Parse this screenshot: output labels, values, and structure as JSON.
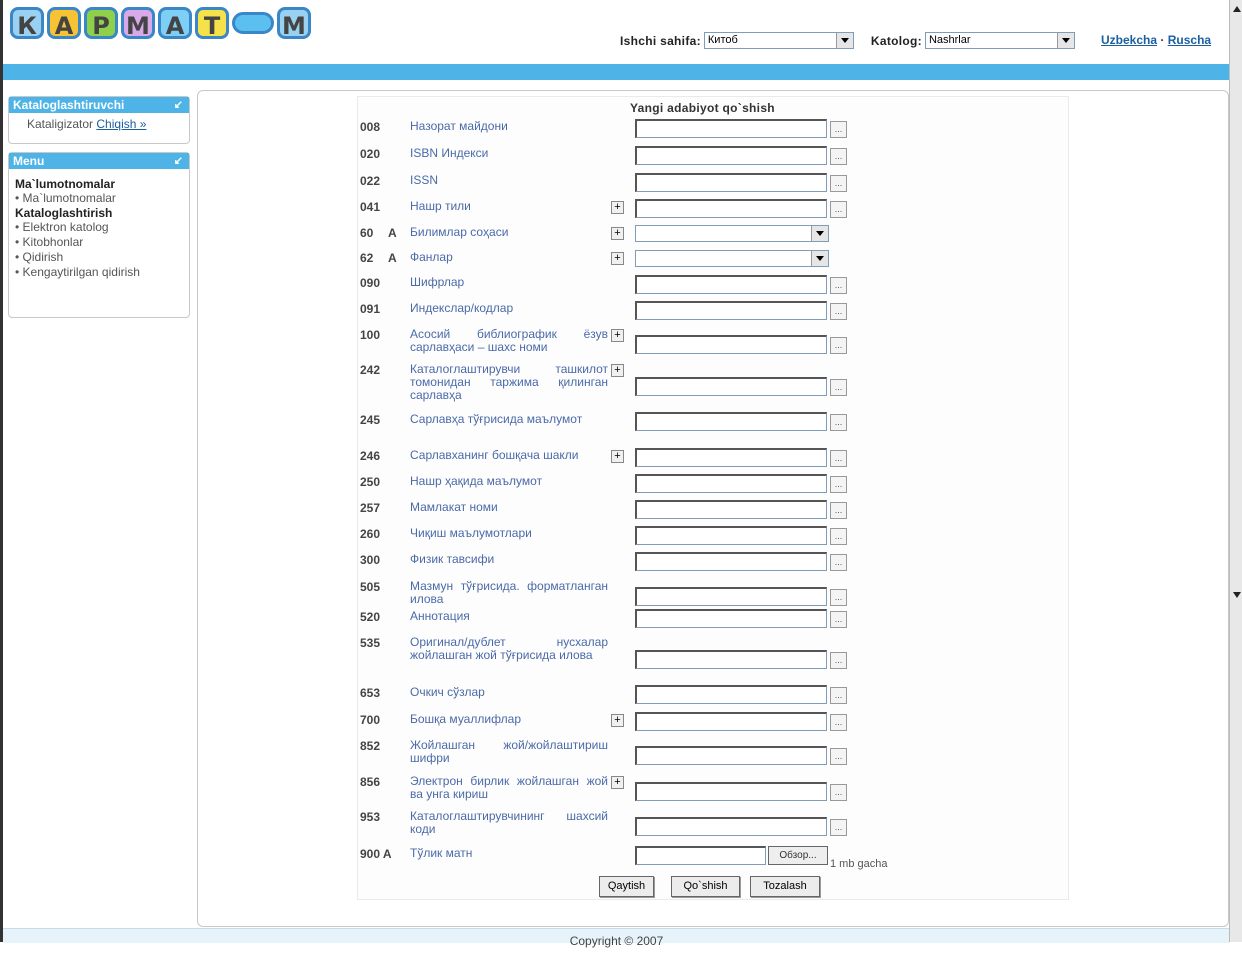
{
  "logo": {
    "letters": [
      "К",
      "А",
      "Р",
      "М",
      "А",
      "Т",
      "",
      "М"
    ]
  },
  "header": {
    "work_page_label": "Ishchi sahifa:",
    "work_page_value": "Китоб",
    "catalog_label": "Katolog:",
    "catalog_value": "Nashrlar",
    "lang_uz": "Uzbekcha",
    "lang_sep": "·",
    "lang_ru": "Ruscha"
  },
  "sidebar": {
    "box1": {
      "title": "Kataloglashtiruvchi",
      "user": "Kataligizator",
      "logout": "Chiqish »"
    },
    "box2": {
      "title": "Menu",
      "group1": "Ma`lumotnomalar",
      "group1_items": [
        "Ma`lumotnomalar"
      ],
      "group2": "Kataloglashtirish",
      "group2_items": [
        "Elektron katolog",
        "Kitobhonlar",
        "Qidirish",
        "Kengaytirilgan qidirish"
      ]
    }
  },
  "form": {
    "title": "Yangi adabiyot qo`shish",
    "fields": [
      {
        "code": "008",
        "flag": "",
        "label": "Назорат майдони",
        "plus": false,
        "type": "text"
      },
      {
        "code": "020",
        "flag": "",
        "label": "ISBN Индекси",
        "plus": false,
        "type": "text"
      },
      {
        "code": "022",
        "flag": "",
        "label": "ISSN",
        "plus": false,
        "type": "text"
      },
      {
        "code": "041",
        "flag": "",
        "label": "Нашр тили",
        "plus": true,
        "type": "text"
      },
      {
        "code": "60",
        "flag": "A",
        "label": "Билимлар соҳаси",
        "plus": true,
        "type": "select"
      },
      {
        "code": "62",
        "flag": "A",
        "label": "Фанлар",
        "plus": true,
        "type": "select"
      },
      {
        "code": "090",
        "flag": "",
        "label": "Шифрлар",
        "plus": false,
        "type": "text"
      },
      {
        "code": "091",
        "flag": "",
        "label": "Индекслар/кодлар",
        "plus": false,
        "type": "text"
      },
      {
        "code": "100",
        "flag": "",
        "label": "Асосий библиографик ёзув сарлавҳаси – шахс номи",
        "plus": true,
        "type": "text"
      },
      {
        "code": "242",
        "flag": "",
        "label": "Каталоглаштирувчи ташкилот томонидан таржима қилинган сарлавҳа",
        "plus": true,
        "type": "text"
      },
      {
        "code": "245",
        "flag": "",
        "label": "Сарлавҳа тўғрисида маълумот",
        "plus": false,
        "type": "text"
      },
      {
        "code": "246",
        "flag": "",
        "label": "Сарлавханинг бошқача шакли",
        "plus": true,
        "type": "text"
      },
      {
        "code": "250",
        "flag": "",
        "label": "Нашр ҳақида маълумот",
        "plus": false,
        "type": "text"
      },
      {
        "code": "257",
        "flag": "",
        "label": "Мамлакат номи",
        "plus": false,
        "type": "text"
      },
      {
        "code": "260",
        "flag": "",
        "label": "Чиқиш маълумотлари",
        "plus": false,
        "type": "text"
      },
      {
        "code": "300",
        "flag": "",
        "label": "Физик тавсифи",
        "plus": false,
        "type": "text"
      },
      {
        "code": "505",
        "flag": "",
        "label": "Мазмун тўғрисида. форматланган илова",
        "plus": false,
        "type": "text"
      },
      {
        "code": "520",
        "flag": "",
        "label": "Аннотация",
        "plus": false,
        "type": "text"
      },
      {
        "code": "535",
        "flag": "",
        "label": "Оригинал/дублет нусхалар жойлашган жой тўғрисида илова",
        "plus": false,
        "type": "text"
      },
      {
        "code": "653",
        "flag": "",
        "label": "Очкич сўзлар",
        "plus": false,
        "type": "text"
      },
      {
        "code": "700",
        "flag": "",
        "label": "Бошқа муаллифлар",
        "plus": true,
        "type": "text"
      },
      {
        "code": "852",
        "flag": "",
        "label": "Жойлашган жой/жойлаштириш шифри",
        "plus": false,
        "type": "text"
      },
      {
        "code": "856",
        "flag": "",
        "label": "Электрон бирлик жойлашган жой ва унга кириш",
        "plus": true,
        "type": "text"
      },
      {
        "code": "953",
        "flag": "",
        "label": "Каталоглаштирувчининг шахсий коди",
        "plus": false,
        "type": "text"
      }
    ],
    "fulltext": {
      "code": "900 A",
      "label": "Тўлик матн",
      "browse": "Обзор...",
      "note": "1 mb gacha"
    },
    "buttons": {
      "back": "Qaytish",
      "add": "Qo`shish",
      "clear": "Tozalash"
    },
    "plus_glyph": "+",
    "dots_glyph": "..."
  },
  "footer": {
    "copyright": "Copyright © 2007"
  }
}
